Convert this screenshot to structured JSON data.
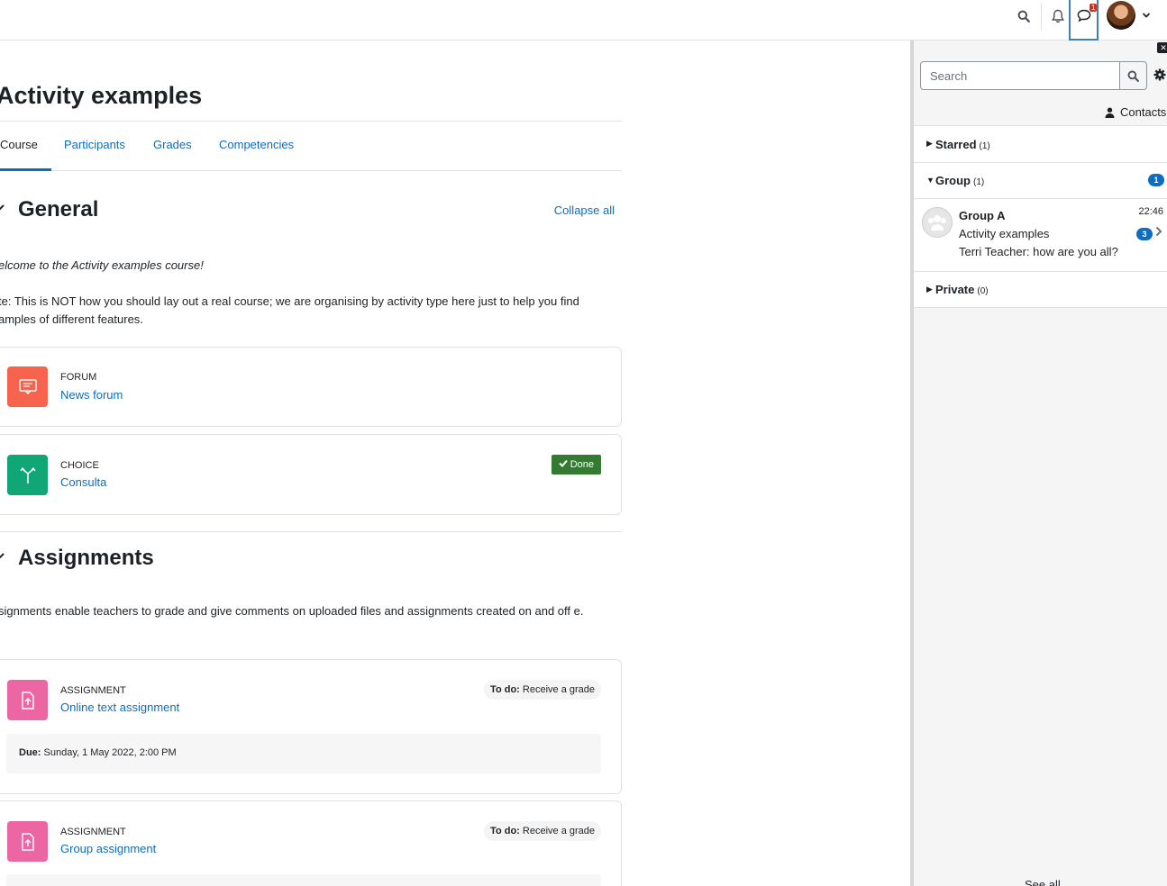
{
  "navbar": {
    "message_badge": "1"
  },
  "course": {
    "title": "Activity examples",
    "tabs": [
      {
        "label": "Course"
      },
      {
        "label": "Participants"
      },
      {
        "label": "Grades"
      },
      {
        "label": "Competencies"
      }
    ],
    "collapse_all": "Collapse all"
  },
  "sections": {
    "general": {
      "title": "General",
      "welcome": "elcome to the Activity examples course!",
      "note": "te: This is NOT how you should lay out a real course; we are organising by activity type here just to help you find amples of different features.",
      "activities": [
        {
          "type": "FORUM",
          "name": "News forum"
        },
        {
          "type": "CHOICE",
          "name": "Consulta",
          "status": "Done"
        }
      ]
    },
    "assignments": {
      "title": "Assignments",
      "description": "signments enable teachers to grade and give comments on uploaded files and assignments created on and off e.",
      "activities": [
        {
          "type": "ASSIGNMENT",
          "name": "Online text assignment",
          "todo_label": "To do:",
          "todo_value": "Receive a grade",
          "due_label": "Due:",
          "due_value": "Sunday, 1 May 2022, 2:00 PM"
        },
        {
          "type": "ASSIGNMENT",
          "name": "Group assignment",
          "todo_label": "To do:",
          "todo_value": "Receive a grade"
        }
      ]
    }
  },
  "drawer": {
    "search_placeholder": "Search",
    "contacts_label": "Contacts",
    "starred": {
      "label": "Starred",
      "count": "(1)"
    },
    "group": {
      "label": "Group",
      "count": "(1)",
      "unread": "1"
    },
    "private": {
      "label": "Private",
      "count": "(0)"
    },
    "conversation": {
      "name": "Group A",
      "time": "22:46",
      "course": "Activity examples",
      "last_message": "Terri Teacher: how are you all?",
      "unread": "3"
    },
    "see_all": "See all"
  },
  "colors": {
    "link": "#0f6cbf",
    "forum_icon": "#f7634d",
    "choice_icon": "#11a676",
    "assignment_icon": "#eb66a2",
    "done_badge": "#357a32"
  }
}
